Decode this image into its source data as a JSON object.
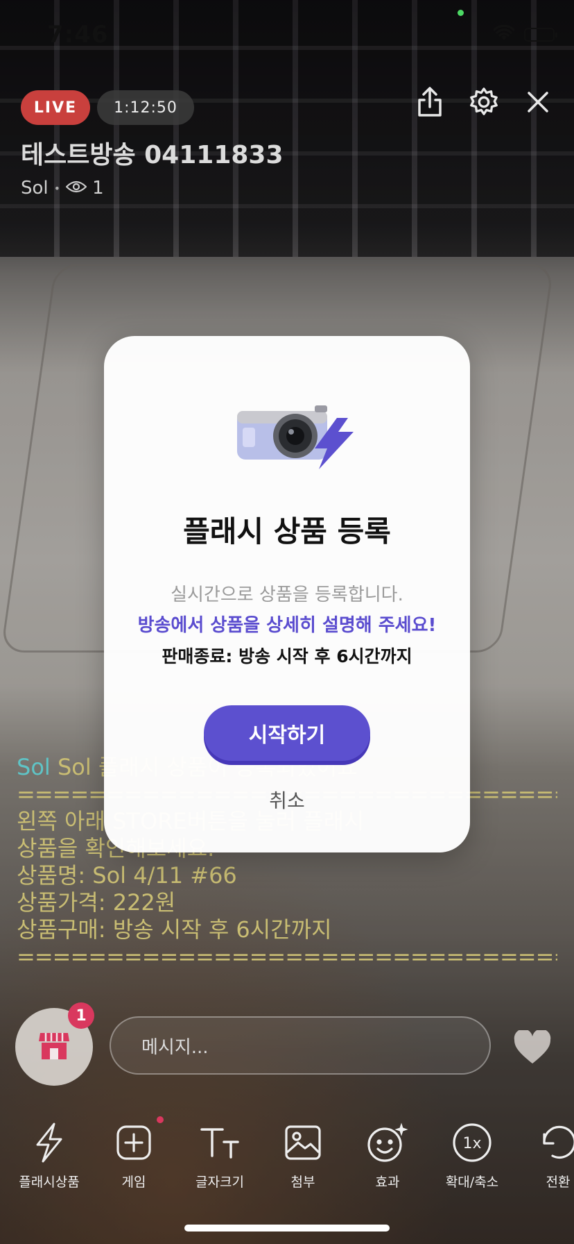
{
  "status_bar": {
    "time": "7:46"
  },
  "broadcast": {
    "live_label": "LIVE",
    "elapsed": "1:12:50",
    "title": "테스트방송 04111833",
    "host": "Sol",
    "viewer_count": "1"
  },
  "chat": {
    "sender_name": "Sol",
    "message_prefix": "Sol 플래시 상품이 등록되었어요",
    "separator": "===============================",
    "lines": [
      "왼쪽 아래 STORE버튼을 눌러 플래시",
      "상품을 확인해보세요.",
      "상품명: Sol 4/11 #66",
      "상품가격: 222원",
      "상품구매: 방송 시작 후 6시간까지"
    ],
    "separator_end": "==============================="
  },
  "store": {
    "badge_count": "1"
  },
  "message_input": {
    "placeholder": "메시지..."
  },
  "toolbar": {
    "flash": "플래시상품",
    "game": "게임",
    "font_size": "글자크기",
    "attach": "첨부",
    "effect": "효과",
    "zoom": "확대/축소",
    "switch": "전환",
    "zoom_icon_text": "1x"
  },
  "modal": {
    "title": "플래시 상품 등록",
    "desc1": "실시간으로 상품을 등록합니다.",
    "desc2": "방송에서 상품을 상세히 설명해 주세요!",
    "desc3": "판매종료: 방송 시작 후 6시간까지",
    "start_label": "시작하기",
    "cancel_label": "취소"
  },
  "colors": {
    "accent": "#5c50cf",
    "live": "#c9403d",
    "badge": "#d9385e",
    "chat_text": "#c9bd73",
    "chat_name": "#5fc4c6"
  }
}
